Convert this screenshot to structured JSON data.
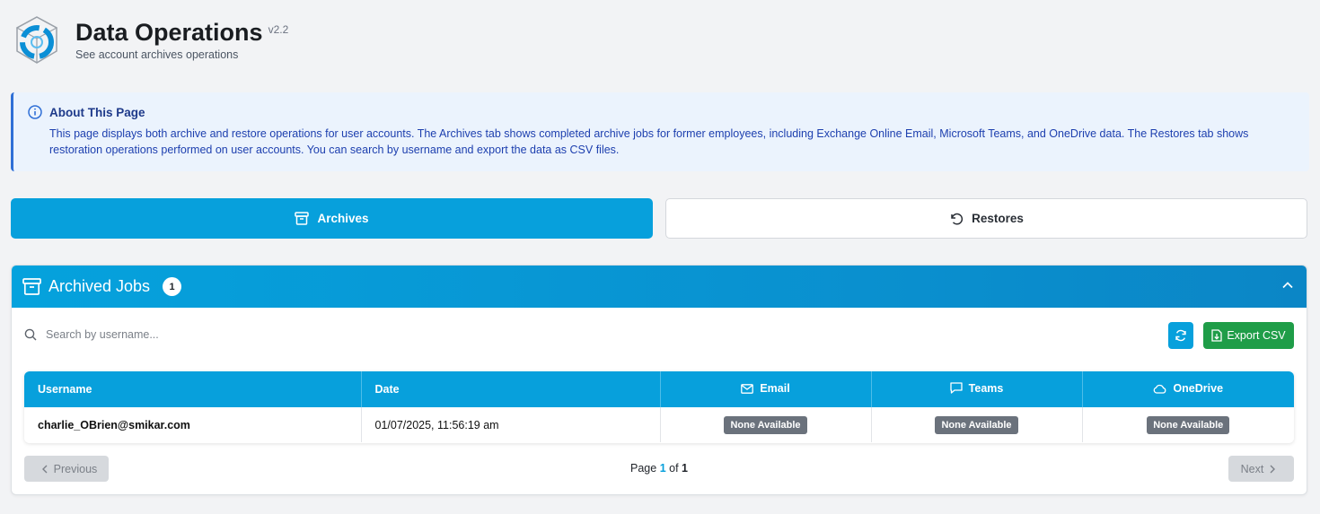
{
  "header": {
    "title": "Data Operations",
    "version": "v2.2",
    "subtitle": "See account archives operations"
  },
  "info": {
    "heading": "About This Page",
    "text": "This page displays both archive and restore operations for user accounts. The Archives tab shows completed archive jobs for former employees, including Exchange Online Email, Microsoft Teams, and OneDrive data. The Restores tab shows restoration operations performed on user accounts. You can search by username and export the data as CSV files."
  },
  "tabs": [
    {
      "label": "Archives",
      "active": true,
      "icon": "archive-icon"
    },
    {
      "label": "Restores",
      "active": false,
      "icon": "restore-icon"
    }
  ],
  "card": {
    "title": "Archived Jobs",
    "count": "1"
  },
  "search": {
    "placeholder": "Search by username..."
  },
  "toolbar": {
    "export_label": "Export CSV"
  },
  "table": {
    "columns": [
      "Username",
      "Date",
      "Email",
      "Teams",
      "OneDrive"
    ],
    "rows": [
      {
        "username": "charlie_OBrien@smikar.com",
        "date": "01/07/2025, 11:56:19 am",
        "email": "None Available",
        "teams": "None Available",
        "onedrive": "None Available"
      }
    ]
  },
  "pagination": {
    "prev_label": "Previous",
    "next_label": "Next",
    "page_word": "Page",
    "of_word": "of",
    "current": "1",
    "total": "1"
  },
  "colors": {
    "primary": "#07a0dc",
    "success": "#1f9d48",
    "badge": "#6b727c",
    "info_bg": "#ebf3fd",
    "info_border": "#2f6fd6"
  }
}
